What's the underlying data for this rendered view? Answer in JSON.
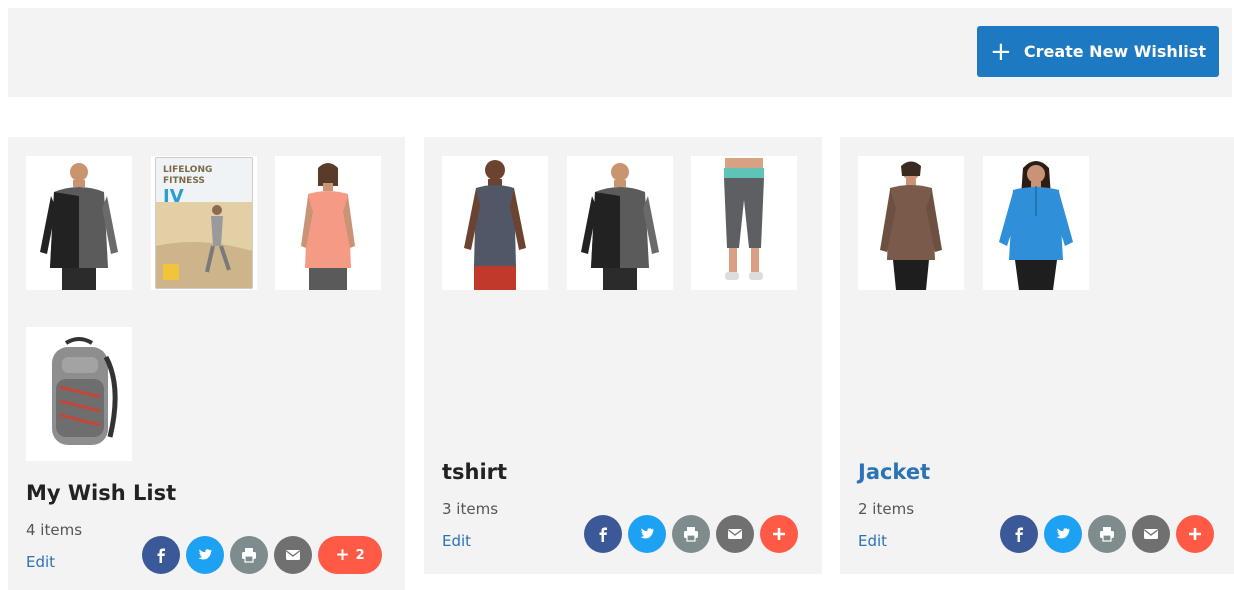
{
  "toolbar": {
    "create_label": "Create New Wishlist",
    "create_icon": "plus-icon",
    "accent": "#1d79c2"
  },
  "wishlists": [
    {
      "title": "My Wish List",
      "count": "4 items",
      "edit_label": "Edit",
      "more_count": "2",
      "products": [
        "gray zip hoodie jacket",
        "Lifelong Fitness IV dvd",
        "coral women's tee",
        "gray and red backpack"
      ]
    },
    {
      "title": "tshirt",
      "count": "3 items",
      "edit_label": "Edit",
      "products": [
        "gray sleeveless tank",
        "gray zip hoodie jacket",
        "gray capri leggings"
      ]
    },
    {
      "title": "Jacket",
      "count": "2 items",
      "edit_label": "Edit",
      "products": [
        "brown women's jacket",
        "blue half-zip pullover"
      ]
    }
  ],
  "share_icons": [
    "facebook-icon",
    "twitter-icon",
    "print-icon",
    "email-icon",
    "add-share-icon"
  ],
  "colors": {
    "facebook": "#3b5998",
    "twitter": "#1da1f2",
    "print": "#7f8c8d",
    "email": "#707070",
    "more": "#ff5a45",
    "link": "#2b72b6"
  },
  "dvd_cover_text": {
    "line1": "LIFELONG",
    "line2": "FITNESS",
    "line3": "IV"
  }
}
